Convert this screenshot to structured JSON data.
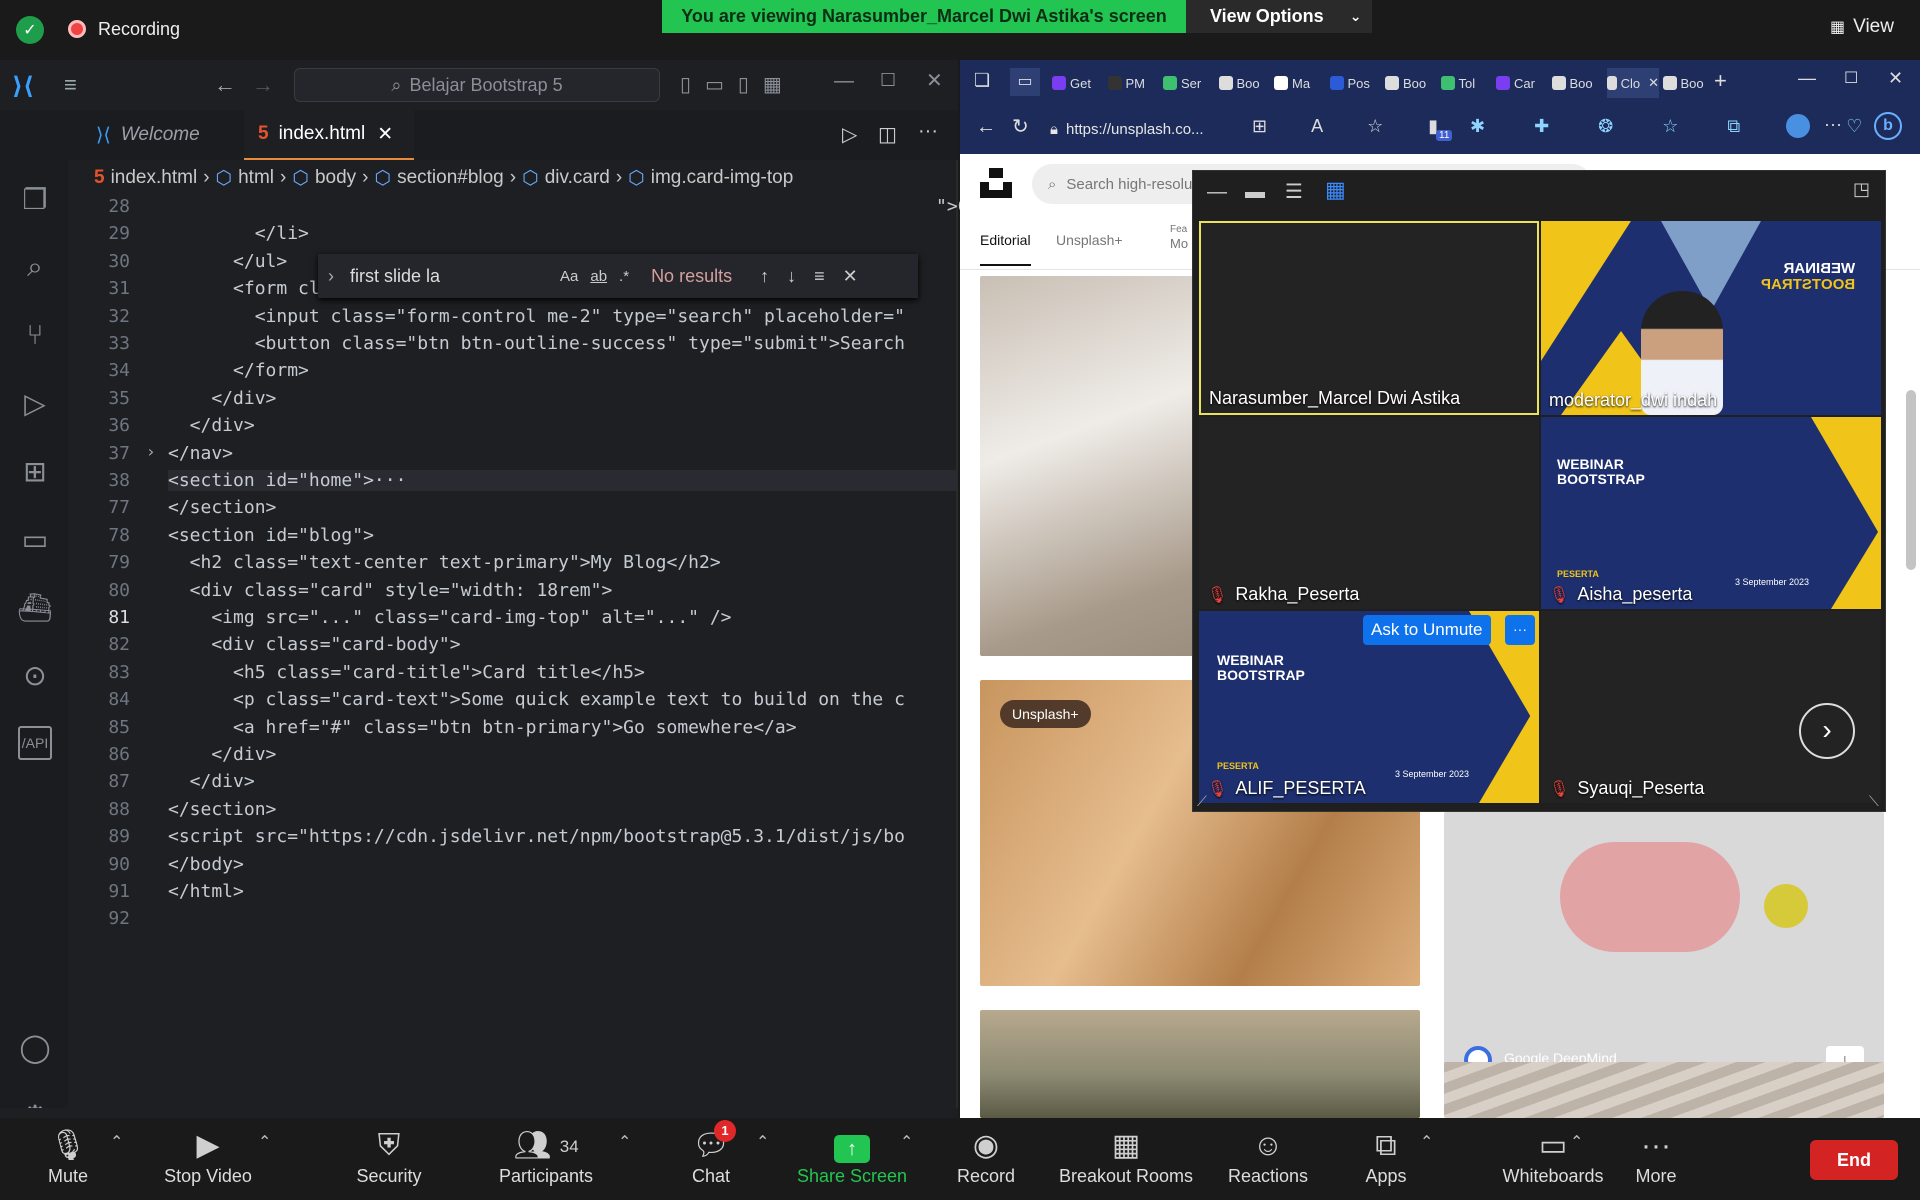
{
  "zoom_top": {
    "recording_label": "Recording",
    "viewing_banner": "You are viewing Narasumber_Marcel Dwi Astika's screen",
    "view_options_label": "View Options",
    "view_label": "View"
  },
  "vscode": {
    "search_title": "Belajar Bootstrap 5",
    "tabs": [
      {
        "label": "Welcome"
      },
      {
        "label": "index.html"
      }
    ],
    "breadcrumb": [
      "index.html",
      "html",
      "body",
      "section#blog",
      "div.card",
      "img.card-img-top"
    ],
    "find": {
      "query": "first slide la",
      "aa": "Aa",
      "ab": "ab",
      "regex": ".*",
      "results": "No results"
    },
    "lines": [
      {
        "n": "28",
        "text": ""
      },
      {
        "n": "29",
        "text": "        </li>"
      },
      {
        "n": "30",
        "text": "      </ul>"
      },
      {
        "n": "31",
        "text": "      <form class=\"d-flex\" role=\"search\">"
      },
      {
        "n": "32",
        "text": "        <input class=\"form-control me-2\" type=\"search\" placeholder=\""
      },
      {
        "n": "33",
        "text": "        <button class=\"btn btn-outline-success\" type=\"submit\">Search"
      },
      {
        "n": "34",
        "text": "      </form>"
      },
      {
        "n": "35",
        "text": "    </div>"
      },
      {
        "n": "36",
        "text": "  </div>"
      },
      {
        "n": "37",
        "text": "</nav>"
      },
      {
        "n": "38",
        "text": "<section id=\"home\">···"
      },
      {
        "n": "77",
        "text": "</section>"
      },
      {
        "n": "78",
        "text": "<section id=\"blog\">"
      },
      {
        "n": "79",
        "text": "  <h2 class=\"text-center text-primary\">My Blog</h2>"
      },
      {
        "n": "80",
        "text": "  <div class=\"card\" style=\"width: 18rem\">"
      },
      {
        "n": "81",
        "text": "    <img src=\"...\" class=\"card-img-top\" alt=\"...\" />"
      },
      {
        "n": "82",
        "text": "    <div class=\"card-body\">"
      },
      {
        "n": "83",
        "text": "      <h5 class=\"card-title\">Card title</h5>"
      },
      {
        "n": "84",
        "text": "      <p class=\"card-text\">Some quick example text to build on the c"
      },
      {
        "n": "85",
        "text": "      <a href=\"#\" class=\"btn btn-primary\">Go somewhere</a>"
      },
      {
        "n": "86",
        "text": "    </div>"
      },
      {
        "n": "87",
        "text": "  </div>"
      },
      {
        "n": "88",
        "text": "</section>"
      },
      {
        "n": "89",
        "text": "<script src=\"https://cdn.jsdelivr.net/npm/bootstrap@5.3.1/dist/js/bo"
      },
      {
        "n": "90",
        "text": "</body>"
      },
      {
        "n": "91",
        "text": "</html>"
      },
      {
        "n": "92",
        "text": ""
      }
    ],
    "line28_tail": "\">Co"
  },
  "browser": {
    "tabs": [
      "Get",
      "PM",
      "Ser",
      "Boo",
      "Ma",
      "Pos",
      "Boo",
      "Tol",
      "Car",
      "Boo",
      "Clo",
      "Boo"
    ],
    "url": "https://unsplash.co...",
    "ext_badge": "11",
    "search_placeholder": "Search high-resolution images",
    "nav": [
      "Editorial",
      "Unsplash+",
      "Fea",
      "Mo"
    ],
    "badge_unsplash_plus": "Unsplash+",
    "deepmind_label": "Google DeepMind"
  },
  "gallery": {
    "participants": [
      {
        "name": "Narasumber_Marcel Dwi Astika",
        "muted": false
      },
      {
        "name": "moderator_dwi indah",
        "muted": false
      },
      {
        "name": "Rakha_Peserta",
        "muted": true
      },
      {
        "name": "Aisha_peserta",
        "muted": true
      },
      {
        "name": "ALIF_PESERTA",
        "muted": true
      },
      {
        "name": "Syauqi_Peserta",
        "muted": true
      }
    ],
    "ask_unmute": "Ask to Unmute",
    "more": "···",
    "webinar_title": "WEBINAR BOOTSTRAP",
    "webinar_peserta": "PESERTA",
    "webinar_date": "3 September 2023"
  },
  "zoom_bottom": {
    "mute": "Mute",
    "stop_video": "Stop Video",
    "security": "Security",
    "participants": "Participants",
    "participants_count": "34",
    "chat": "Chat",
    "chat_badge": "1",
    "share_screen": "Share Screen",
    "record": "Record",
    "breakout_rooms": "Breakout Rooms",
    "reactions": "Reactions",
    "apps": "Apps",
    "whiteboards": "Whiteboards",
    "more": "More",
    "end": "End"
  }
}
